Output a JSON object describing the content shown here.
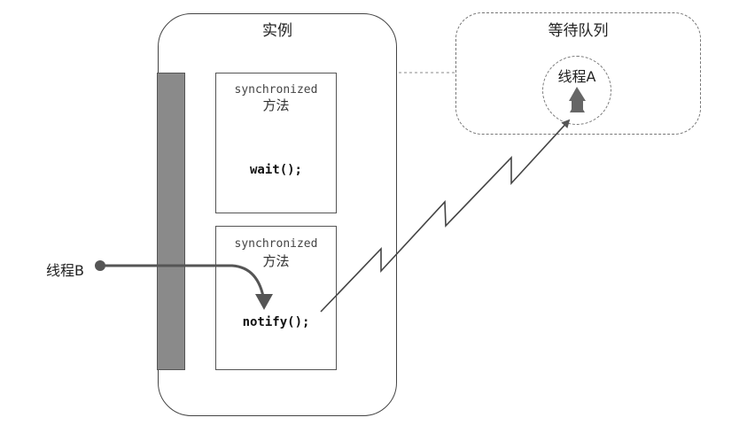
{
  "instance": {
    "title": "实例"
  },
  "methods": [
    {
      "keyword": "synchronized",
      "name": "方法",
      "call": "wait();"
    },
    {
      "keyword": "synchronized",
      "name": "方法",
      "call": "notify();"
    }
  ],
  "wait_queue": {
    "title": "等待队列",
    "thread_label": "线程A"
  },
  "caller": {
    "thread_label": "线程B"
  }
}
